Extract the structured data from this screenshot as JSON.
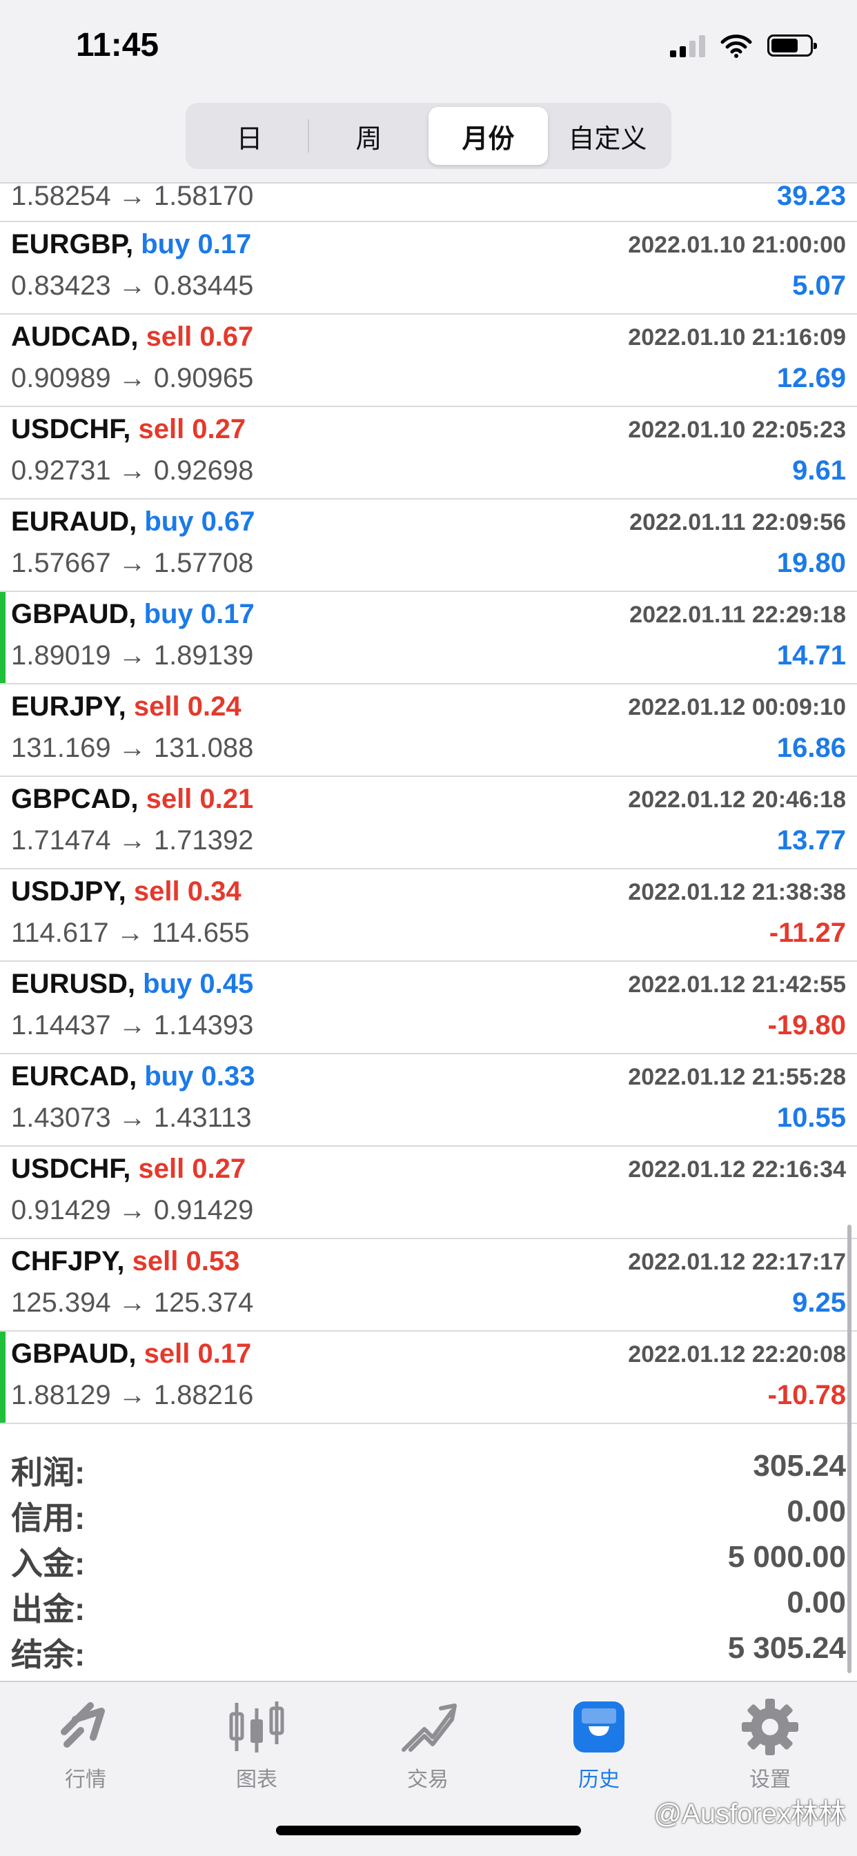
{
  "status": {
    "time": "11:45"
  },
  "periods": [
    {
      "label": "日",
      "selected": false
    },
    {
      "label": "周",
      "selected": false
    },
    {
      "label": "月份",
      "selected": true
    },
    {
      "label": "自定义",
      "selected": false
    }
  ],
  "first_row": {
    "prices": "1.58254 → 1.58170",
    "profit": "39.23"
  },
  "trades": [
    {
      "symbol": "EURGBP,",
      "side": "buy 0.17",
      "time": "2022.01.10 21:00:00",
      "prices": "0.83423 → 0.83445",
      "profit": "5.07"
    },
    {
      "symbol": "AUDCAD,",
      "side": "sell 0.67",
      "time": "2022.01.10 21:16:09",
      "prices": "0.90989 → 0.90965",
      "profit": "12.69"
    },
    {
      "symbol": "USDCHF,",
      "side": "sell 0.27",
      "time": "2022.01.10 22:05:23",
      "prices": "0.92731 → 0.92698",
      "profit": "9.61"
    },
    {
      "symbol": "EURAUD,",
      "side": "buy 0.67",
      "time": "2022.01.11 22:09:56",
      "prices": "1.57667 → 1.57708",
      "profit": "19.80"
    },
    {
      "symbol": "GBPAUD,",
      "side": "buy 0.17",
      "time": "2022.01.11 22:29:18",
      "prices": "1.89019 → 1.89139",
      "profit": "14.71",
      "marked": true
    },
    {
      "symbol": "EURJPY,",
      "side": "sell 0.24",
      "time": "2022.01.12 00:09:10",
      "prices": "131.169 → 131.088",
      "profit": "16.86"
    },
    {
      "symbol": "GBPCAD,",
      "side": "sell 0.21",
      "time": "2022.01.12 20:46:18",
      "prices": "1.71474 → 1.71392",
      "profit": "13.77"
    },
    {
      "symbol": "USDJPY,",
      "side": "sell 0.34",
      "time": "2022.01.12 21:38:38",
      "prices": "114.617 → 114.655",
      "profit": "-11.27"
    },
    {
      "symbol": "EURUSD,",
      "side": "buy 0.45",
      "time": "2022.01.12 21:42:55",
      "prices": "1.14437 → 1.14393",
      "profit": "-19.80"
    },
    {
      "symbol": "EURCAD,",
      "side": "buy 0.33",
      "time": "2022.01.12 21:55:28",
      "prices": "1.43073 → 1.43113",
      "profit": "10.55"
    },
    {
      "symbol": "USDCHF,",
      "side": "sell 0.27",
      "time": "2022.01.12 22:16:34",
      "prices": "0.91429 → 0.91429",
      "profit": ""
    },
    {
      "symbol": "CHFJPY,",
      "side": "sell 0.53",
      "time": "2022.01.12 22:17:17",
      "prices": "125.394 → 125.374",
      "profit": "9.25"
    },
    {
      "symbol": "GBPAUD,",
      "side": "sell 0.17",
      "time": "2022.01.12 22:20:08",
      "prices": "1.88129 → 1.88216",
      "profit": "-10.78",
      "marked": true
    }
  ],
  "summary": [
    {
      "label": "利润:",
      "value": "305.24"
    },
    {
      "label": "信用:",
      "value": "0.00"
    },
    {
      "label": "入金:",
      "value": "5 000.00"
    },
    {
      "label": "出金:",
      "value": "0.00"
    },
    {
      "label": "结余:",
      "value": "5 305.24"
    }
  ],
  "tabs": [
    {
      "label": "行情",
      "icon": "quotes-icon",
      "active": false
    },
    {
      "label": "图表",
      "icon": "chart-icon",
      "active": false
    },
    {
      "label": "交易",
      "icon": "trade-icon",
      "active": false
    },
    {
      "label": "历史",
      "icon": "history-icon",
      "active": true
    },
    {
      "label": "设置",
      "icon": "settings-icon",
      "active": false
    }
  ],
  "watermark": "@Ausforex林林",
  "colors": {
    "buy": "#1c7ae8",
    "sell": "#e5392c",
    "marker": "#1fbf3a",
    "active_tab": "#1c7ae8"
  }
}
